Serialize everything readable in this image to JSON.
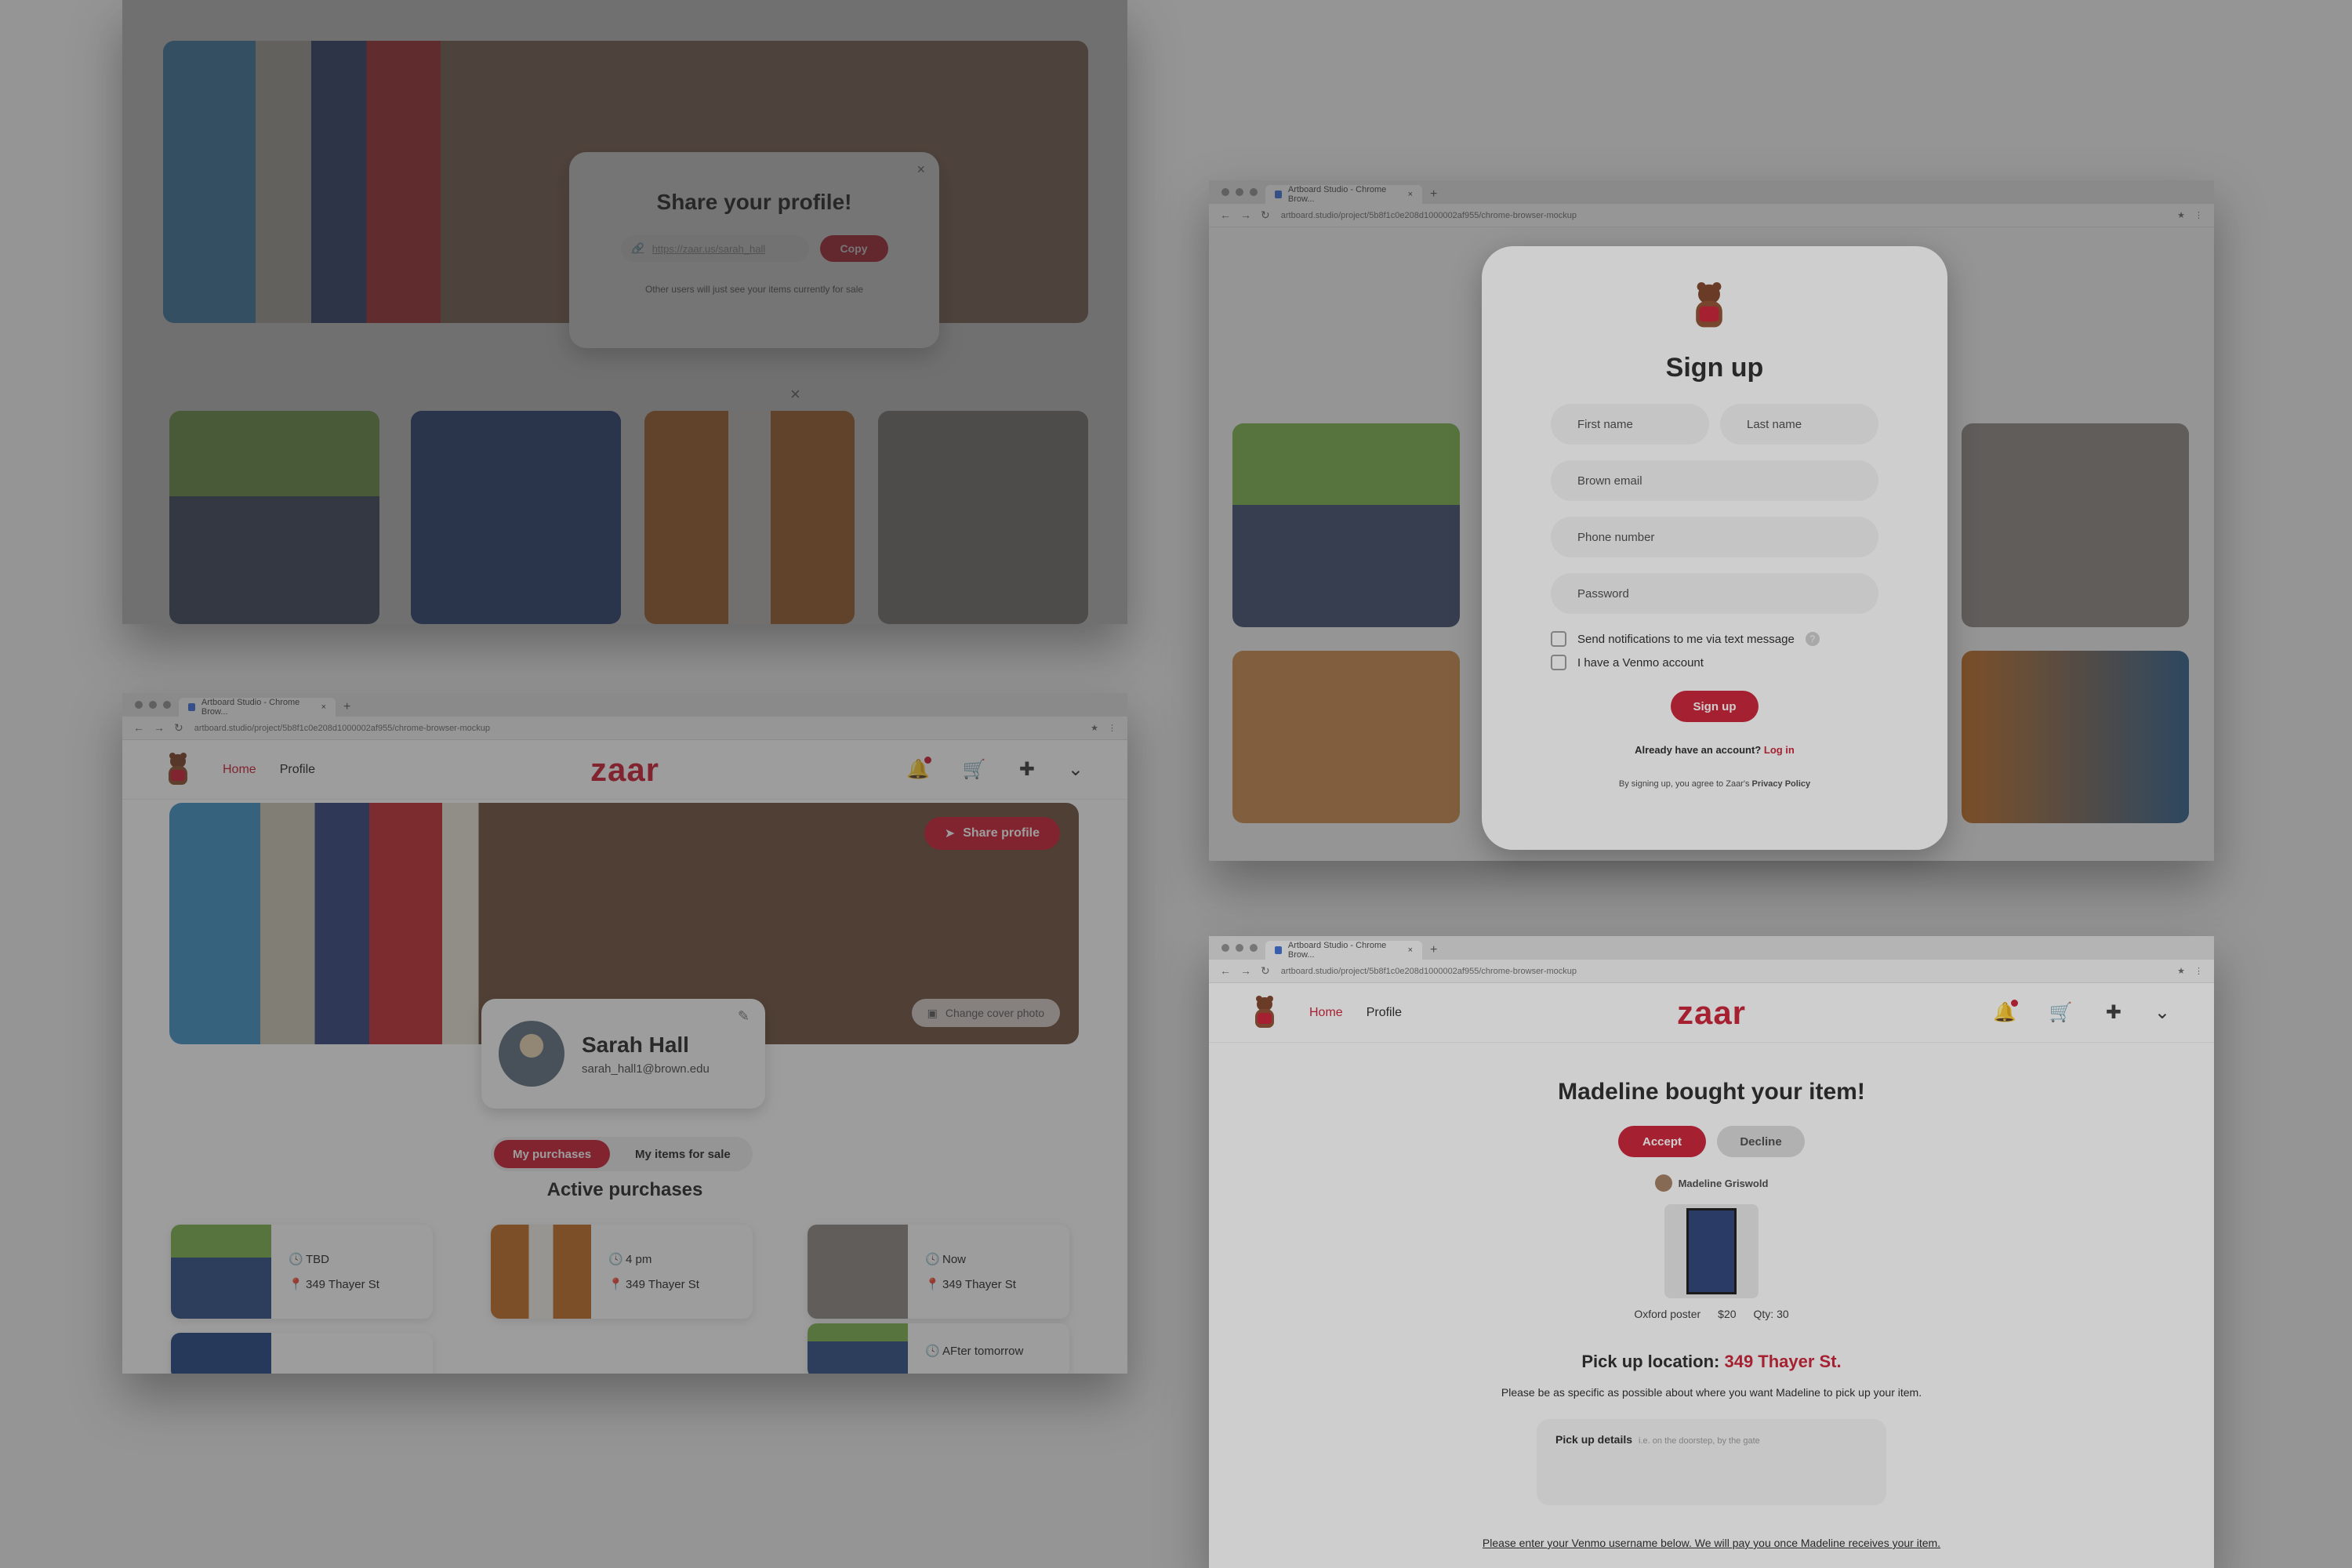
{
  "share_window": {
    "modal_title": "Share your profile!",
    "link_value": "https://zaar.us/sarah_hall",
    "copy_label": "Copy",
    "note": "Other users will just see your items currently for sale",
    "close_glyph": "×",
    "close2_glyph": "×"
  },
  "signup_window": {
    "tab_title": "Artboard Studio - Chrome Brow...",
    "url": "artboard.studio/project/5b8f1c0e208d1000002af955/chrome-browser-mockup",
    "title": "Sign up",
    "first_name_placeholder": "First name",
    "last_name_placeholder": "Last name",
    "email_placeholder": "Brown email",
    "phone_placeholder": "Phone number",
    "password_placeholder": "Password",
    "check_notifications": "Send notifications to me via text message",
    "check_venmo": "I have a Venmo account",
    "help_glyph": "?",
    "signup_label": "Sign up",
    "already_text": "Already have an account?",
    "login_link": "Log in",
    "terms_text": "By signing up, you agree to Zaar's",
    "privacy_link": "Privacy Policy"
  },
  "profile_window": {
    "tab_title": "Artboard Studio - Chrome Brow...",
    "url": "artboard.studio/project/5b8f1c0e208d1000002af955/chrome-browser-mockup",
    "nav_home": "Home",
    "nav_profile": "Profile",
    "logo": "zaar",
    "share_profile_label": "Share profile",
    "change_cover_label": "Change cover photo",
    "name": "Sarah Hall",
    "email": "sarah_hall1@brown.edu",
    "tab_purchases": "My purchases",
    "tab_items": "My items for sale",
    "section_title": "Active purchases",
    "purchases": [
      {
        "time": "TBD",
        "location": "349 Thayer St"
      },
      {
        "time": "4 pm",
        "location": "349 Thayer St"
      },
      {
        "time": "Now",
        "location": "349 Thayer St"
      },
      {
        "time": "AFter tomorrow",
        "location": ""
      }
    ]
  },
  "order_window": {
    "tab_title": "Artboard Studio - Chrome Brow...",
    "url": "artboard.studio/project/5b8f1c0e208d1000002af955/chrome-browser-mockup",
    "nav_home": "Home",
    "nav_profile": "Profile",
    "logo": "zaar",
    "heading": "Madeline bought your item!",
    "accept_label": "Accept",
    "decline_label": "Decline",
    "buyer_name": "Madeline Griswold",
    "item_name": "Oxford poster",
    "item_price": "$20",
    "item_qty": "Qty: 30",
    "pickup_label": "Pick up location:",
    "pickup_location": "349 Thayer St.",
    "pickup_note": "Please be as specific as possible about where you want Madeline to pick up your item.",
    "details_label": "Pick up details",
    "details_placeholder": "i.e. on the doorstep, by the gate",
    "venmo_note": "Please enter your Venmo username below. We will pay you once Madeline receives your item."
  },
  "colors": {
    "brand_red": "#c9192e",
    "background": "#b3b3b3"
  }
}
